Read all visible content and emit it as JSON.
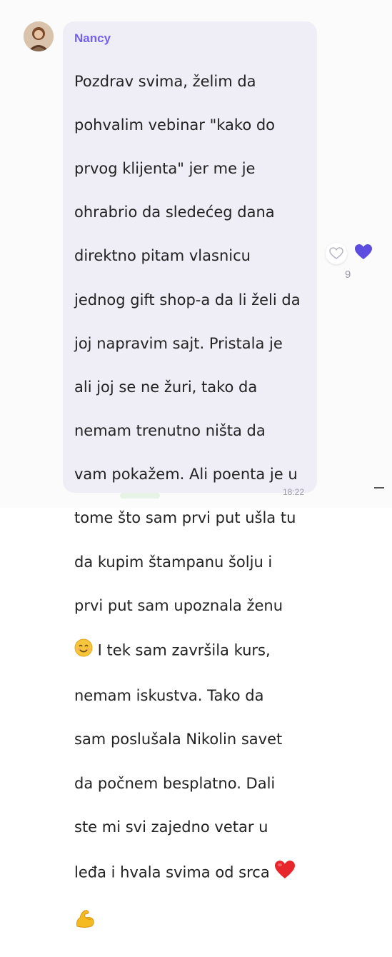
{
  "message": {
    "sender": "Nancy",
    "lines": [
      "Pozdrav svima, želim da",
      "pohvalim vebinar \"kako do",
      "prvog klijenta\" jer me je",
      "ohrabrio da sledećeg dana",
      "direktno pitam vlasnicu",
      "jednog gift shop-a da li želi da",
      "joj napravim sajt. Pristala je",
      "ali joj se ne žuri, tako da",
      "nemam trenutno ništa da",
      "vam pokažem. Ali poenta je u",
      "tome što sam prvi put ušla tu",
      "da kupim štampanu šolju i",
      "prvi put sam upoznala ženu"
    ],
    "line_after_smile": " I tek sam završila kurs,",
    "lines_2": [
      "nemam iskustva. Tako da",
      "sam poslušala Nikolin savet",
      "da počnem besplatno. Dali",
      "ste mi svi zajedno vetar u"
    ],
    "line_before_heart": "leđa i hvala svima od srca ",
    "time": "18:22",
    "emojis": [
      "smiling-face",
      "red-heart",
      "flexed-biceps"
    ]
  },
  "reactions": {
    "like_count": "9",
    "accent": "#7360f2"
  },
  "colors": {
    "bubble": "#efedf5",
    "sender": "#7360f2",
    "text": "#222222",
    "heart_red": "#e8272c",
    "smile_yellow": "#f7c53b",
    "bicep_yellow": "#f5b921"
  }
}
